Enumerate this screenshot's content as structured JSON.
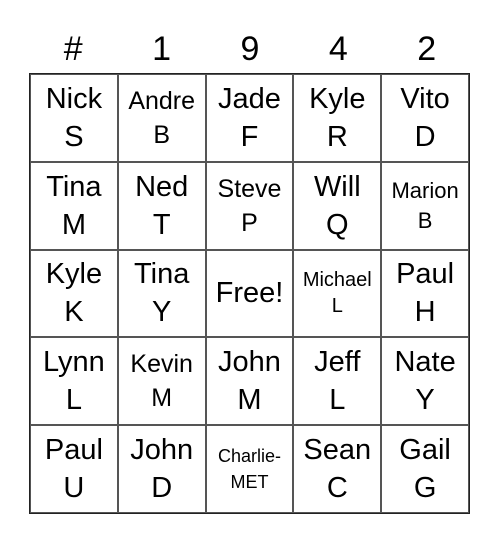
{
  "header": [
    "#",
    "1",
    "9",
    "4",
    "2"
  ],
  "rows": [
    [
      {
        "line1": "Nick",
        "line2": "S",
        "size": "xl"
      },
      {
        "line1": "Andre",
        "line2": "B",
        "size": "l"
      },
      {
        "line1": "Jade",
        "line2": "F",
        "size": "xl"
      },
      {
        "line1": "Kyle",
        "line2": "R",
        "size": "xl"
      },
      {
        "line1": "Vito",
        "line2": "D",
        "size": "xl"
      }
    ],
    [
      {
        "line1": "Tina",
        "line2": "M",
        "size": "xl"
      },
      {
        "line1": "Ned",
        "line2": "T",
        "size": "xl"
      },
      {
        "line1": "Steve",
        "line2": "P",
        "size": "l"
      },
      {
        "line1": "Will",
        "line2": "Q",
        "size": "xl"
      },
      {
        "line1": "Marion",
        "line2": "B",
        "size": "m"
      }
    ],
    [
      {
        "line1": "Kyle",
        "line2": "K",
        "size": "xl"
      },
      {
        "line1": "Tina",
        "line2": "Y",
        "size": "xl"
      },
      {
        "line1": "Free!",
        "line2": "",
        "size": "xl"
      },
      {
        "line1": "Michael",
        "line2": "L",
        "size": "s"
      },
      {
        "line1": "Paul",
        "line2": "H",
        "size": "xl"
      }
    ],
    [
      {
        "line1": "Lynn",
        "line2": "L",
        "size": "xl"
      },
      {
        "line1": "Kevin",
        "line2": "M",
        "size": "l"
      },
      {
        "line1": "John",
        "line2": "M",
        "size": "xl"
      },
      {
        "line1": "Jeff",
        "line2": "L",
        "size": "xl"
      },
      {
        "line1": "Nate",
        "line2": "Y",
        "size": "xl"
      }
    ],
    [
      {
        "line1": "Paul",
        "line2": "U",
        "size": "xl"
      },
      {
        "line1": "John",
        "line2": "D",
        "size": "xl"
      },
      {
        "line1": "Charlie-",
        "line2": "MET",
        "size": "xs"
      },
      {
        "line1": "Sean",
        "line2": "C",
        "size": "xl"
      },
      {
        "line1": "Gail",
        "line2": "G",
        "size": "xl"
      }
    ]
  ]
}
